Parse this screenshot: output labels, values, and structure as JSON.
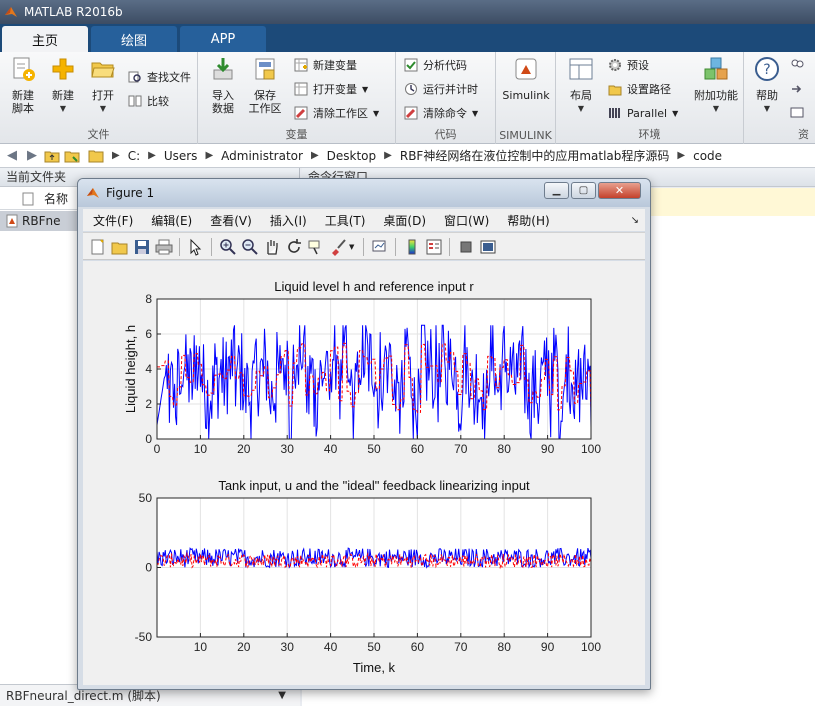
{
  "app": {
    "title": "MATLAB R2016b"
  },
  "tabs": [
    {
      "label": "主页",
      "active": true
    },
    {
      "label": "绘图",
      "active": false
    },
    {
      "label": "APP",
      "active": false
    }
  ],
  "ribbon": {
    "file": {
      "label": "文件",
      "new_script": [
        "新建",
        "脚本"
      ],
      "new": "新建",
      "open": "打开",
      "find_files": "查找文件",
      "compare": "比较"
    },
    "variable": {
      "label": "变量",
      "import_data": [
        "导入",
        "数据"
      ],
      "save_workspace": [
        "保存",
        "工作区"
      ],
      "new_variable": "新建变量",
      "open_variable": "打开变量",
      "clear_workspace": "清除工作区"
    },
    "code": {
      "label": "代码",
      "analyze_code": "分析代码",
      "run_and_time": "运行并计时",
      "clear_commands": "清除命令"
    },
    "simulink": {
      "label": "SIMULINK",
      "button": "Simulink"
    },
    "environment": {
      "label": "环境",
      "layout": "布局",
      "preferences": "预设",
      "set_path": "设置路径",
      "parallel": "Parallel",
      "addons": "附加功能"
    },
    "resources": {
      "label": "资",
      "help": "帮助"
    }
  },
  "address": {
    "crumbs": [
      "C:",
      "Users",
      "Administrator",
      "Desktop",
      "RBF神经网络在液位控制中的应用matlab程序源码",
      "code"
    ]
  },
  "left_panel": {
    "title": "当前文件夹",
    "column_name": "名称",
    "file_row": "RBFne",
    "footer": "RBFneural_direct.m  (脚本)"
  },
  "right_panel": {
    "title": "命令行窗口"
  },
  "figure": {
    "title": "Figure 1",
    "menu": [
      "文件(F)",
      "编辑(E)",
      "查看(V)",
      "插入(I)",
      "工具(T)",
      "桌面(D)",
      "窗口(W)",
      "帮助(H)"
    ]
  },
  "colors": {
    "series_h": "#0000ff",
    "series_r": "#ff0000",
    "ribbon_tab_bar": "#1c4a79"
  },
  "chart_data": [
    {
      "type": "line",
      "title": "Liquid level h and reference input r",
      "xlabel": "",
      "ylabel": "Liquid height, h",
      "xlim": [
        0,
        100
      ],
      "ylim": [
        0,
        8
      ],
      "xticks": [
        0,
        10,
        20,
        30,
        40,
        50,
        60,
        70,
        80,
        90,
        100
      ],
      "yticks": [
        0,
        2,
        4,
        6,
        8
      ],
      "grid": true,
      "series": [
        {
          "color": "#0000ff",
          "description": "noisy level oscillating between ~0.5 and ~6.3"
        },
        {
          "color": "#ff0000",
          "style": "dashed",
          "description": "reference switching between ~1.5 and ~5.5"
        }
      ]
    },
    {
      "type": "line",
      "title": "Tank input, u and the \"ideal\" feedback linearizing input",
      "xlabel": "Time, k",
      "ylabel": "",
      "xlim": [
        0,
        100
      ],
      "ylim": [
        -50,
        50
      ],
      "xticks": [
        10,
        20,
        30,
        40,
        50,
        60,
        70,
        80,
        90,
        100
      ],
      "yticks": [
        -50,
        0,
        50
      ],
      "grid": true,
      "series": [
        {
          "color": "#0000ff",
          "description": "input u fluctuating between ~0 and ~15"
        },
        {
          "color": "#ff0000",
          "style": "dashed",
          "description": "ideal input fluctuating between ~2 and ~12"
        }
      ]
    }
  ]
}
